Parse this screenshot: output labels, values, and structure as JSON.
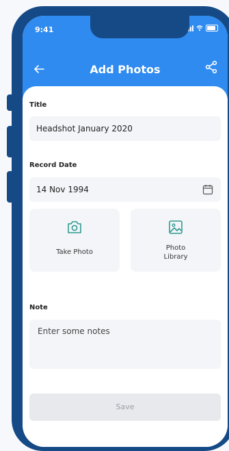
{
  "status_bar": {
    "time": "9:41"
  },
  "header": {
    "title": "Add Photos"
  },
  "form": {
    "title_label": "Title",
    "title_value": "Headshot January 2020",
    "date_label": "Record Date",
    "date_value": "14 Nov 1994",
    "take_photo_label": "Take Photo",
    "library_label_line1": "Photo",
    "library_label_line2": "Library",
    "note_label": "Note",
    "note_placeholder": "Enter some notes",
    "save_label": "Save"
  },
  "colors": {
    "frame": "#154a86",
    "header": "#2f8bf0",
    "accent_icon": "#2f9a91"
  },
  "icons": [
    "back-arrow-icon",
    "share-icon",
    "calendar-icon",
    "camera-icon",
    "image-icon"
  ]
}
